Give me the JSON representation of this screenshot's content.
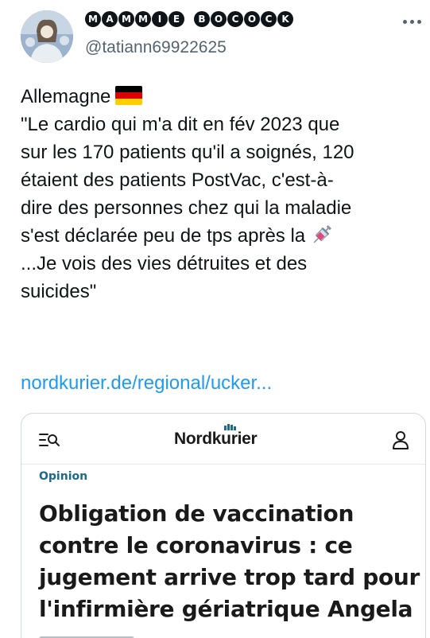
{
  "author": {
    "display_name": "MAMMIE BOCOCK",
    "handle": "@tatiann69922625",
    "avatar_icon": "avatar-image"
  },
  "more_icon": "more-horizontal-icon",
  "tweet": {
    "lines": [
      "Allemagne",
      "\"Le cardio qui m'a dit en fév 2023 que",
      "sur les 170 patients qu'il a soignés, 120",
      "étaient des patients PostVac, c'est-à-",
      "dire des personnes chez qui la maladie",
      "s'est déclarée peu de tps après la",
      "...Je vois des vies détruites et des",
      "suicides\""
    ],
    "flag_icon": "germany-flag-icon",
    "syringe_icon": "syringe-icon",
    "link_text": "nordkurier.de/regional/ucker..."
  },
  "card": {
    "brand": "Nordkurier",
    "menu_icon": "menu-search-icon",
    "user_icon": "user-icon",
    "category": "Opinion",
    "headline_lines": [
      "Obligation de vaccination",
      "contre le coronavirus : ce",
      "jugement arrive trop tard pour",
      "l'infirmière gériatrique Angela"
    ]
  },
  "colors": {
    "text": "#0f1419",
    "secondary": "#536471",
    "link": "#1d9bf0",
    "card_border": "#cfd9de",
    "category": "#1b6a8a"
  }
}
